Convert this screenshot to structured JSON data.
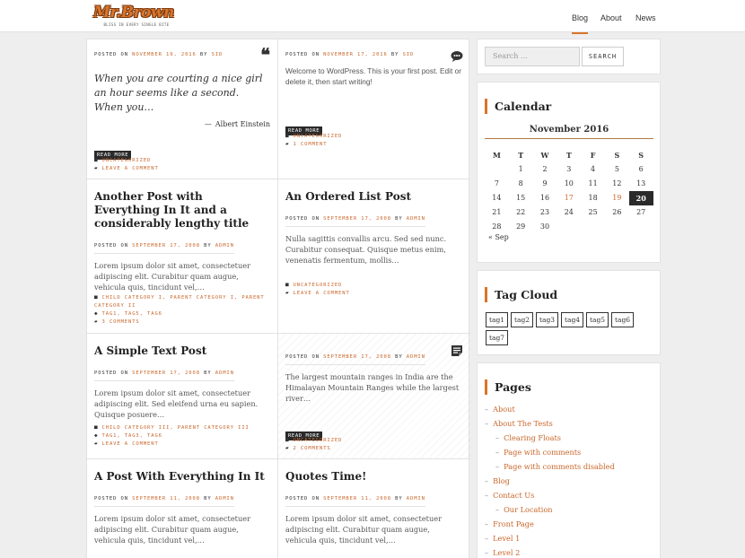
{
  "site": {
    "logo_text": "Mr.Brown",
    "logo_tagline": "BLISS IN EVERY SINGLE BITE",
    "nav": [
      "Blog",
      "About",
      "News"
    ]
  },
  "posts": [
    {
      "meta": [
        "POSTED ON ",
        "NOVEMBER 19, 2016",
        " BY ",
        "SID"
      ],
      "quote": "When you are courting a nice girl an hour seems like a second. When you…",
      "cite": "Albert Einstein",
      "icon": "quote-icon",
      "read_more": "READ MORE",
      "categories": "UNCATEGORIZED",
      "comments": "LEAVE A COMMENT"
    },
    {
      "meta": [
        "POSTED ON ",
        "NOVEMBER 17, 2016",
        " BY ",
        "SID"
      ],
      "excerpt": "Welcome to WordPress. This is your first post. Edit or delete it, then start writing!",
      "icon": "chat-icon",
      "read_more": "READ MORE",
      "categories": "UNCATEGORIZED",
      "comments": "1 COMMENT"
    },
    {
      "title": "Another Post with Everything In It and a considerably lengthy title",
      "meta": [
        "POSTED ON ",
        "SEPTEMBER 17, 2008",
        " BY ",
        "ADMIN"
      ],
      "excerpt": "Lorem ipsum dolor sit amet, consectetuer adipiscing elit. Curabitur quam augue, vehicula quis, tincidunt vel,…",
      "categories": "CHILD CATEGORY I, PARENT CATEGORY I, PARENT CATEGORY II",
      "tags": "TAG1, TAG5, TAG6",
      "comments": "3 COMMENTS"
    },
    {
      "title": "An Ordered List Post",
      "meta": [
        "POSTED ON ",
        "SEPTEMBER 17, 2008",
        " BY ",
        "ADMIN"
      ],
      "excerpt": "Nulla sagittis convallis arcu. Sed sed nunc. Curabitur consequat. Quisque metus enim, venenatis fermentum, mollis…",
      "categories": "UNCATEGORIZED",
      "comments": "LEAVE A COMMENT"
    },
    {
      "title": "A Simple Text Post",
      "meta": [
        "POSTED ON ",
        "SEPTEMBER 17, 2008",
        " BY ",
        "ADMIN"
      ],
      "excerpt": "Lorem ipsum dolor sit amet, consectetuer adipiscing elit. Sed eleifend urna eu sapien. Quisque posuere…",
      "categories": "CHILD CATEGORY III, PARENT CATEGORY III",
      "tags": "TAG1, TAG3, TAG6",
      "comments": "LEAVE A COMMENT"
    },
    {
      "meta": [
        "POSTED ON ",
        "SEPTEMBER 17, 2008",
        " BY ",
        "ADMIN"
      ],
      "excerpt": "The largest mountain ranges in India are the Himalayan Mountain Ranges while the largest river…",
      "icon": "document-icon",
      "read_more": "READ MORE",
      "categories": "UNCATEGORIZED",
      "comments": "2 COMMENTS"
    },
    {
      "title": "A Post With Everything In It",
      "meta": [
        "POSTED ON ",
        "SEPTEMBER 11, 2008",
        " BY ",
        "ADMIN"
      ],
      "excerpt": "Lorem ipsum dolor sit amet, consectetuer adipiscing elit. Curabitur quam augue, vehicula quis, tincidunt vel,…"
    },
    {
      "title": "Quotes Time!",
      "meta": [
        "POSTED ON ",
        "SEPTEMBER 11, 2008",
        " BY ",
        "ADMIN"
      ],
      "excerpt": "Lorem ipsum dolor sit amet, consectetuer adipiscing elit. Curabitur quam augue, vehicula quis, tincidunt vel,…"
    }
  ],
  "sidebar": {
    "search": {
      "placeholder": "Search …",
      "button": "SEARCH"
    },
    "calendar": {
      "title": "Calendar",
      "caption": "November 2016",
      "weekdays": [
        "M",
        "T",
        "W",
        "T",
        "F",
        "S",
        "S"
      ],
      "rows": [
        [
          "",
          "1",
          "2",
          "3",
          "4",
          "5",
          "6"
        ],
        [
          "7",
          "8",
          "9",
          "10",
          "11",
          "12",
          "13"
        ],
        [
          "14",
          "15",
          "16",
          "17",
          "18",
          "19",
          "20"
        ],
        [
          "21",
          "22",
          "23",
          "24",
          "25",
          "26",
          "27"
        ],
        [
          "28",
          "29",
          "30",
          "",
          "",
          "",
          ""
        ]
      ],
      "linked_days": [
        "17",
        "19"
      ],
      "today": "20",
      "prev": "« Sep"
    },
    "tag_cloud": {
      "title": "Tag Cloud",
      "tags": [
        "tag1",
        "tag2",
        "tag3",
        "tag4",
        "tag5",
        "tag6",
        "tag7"
      ]
    },
    "pages": {
      "title": "Pages",
      "items": [
        {
          "label": "About",
          "level": 0
        },
        {
          "label": "About The Tests",
          "level": 0
        },
        {
          "label": "Clearing Floats",
          "level": 1
        },
        {
          "label": "Page with comments",
          "level": 1
        },
        {
          "label": "Page with comments disabled",
          "level": 1
        },
        {
          "label": "Blog",
          "level": 0
        },
        {
          "label": "Contact Us",
          "level": 0
        },
        {
          "label": "Our Location",
          "level": 1
        },
        {
          "label": "Front Page",
          "level": 0
        },
        {
          "label": "Level 1",
          "level": 0
        },
        {
          "label": "Level 2",
          "level": 0
        }
      ]
    }
  },
  "colors": {
    "accent": "#d9742a",
    "link": "#c9662a",
    "dark": "#2a2a2a"
  }
}
